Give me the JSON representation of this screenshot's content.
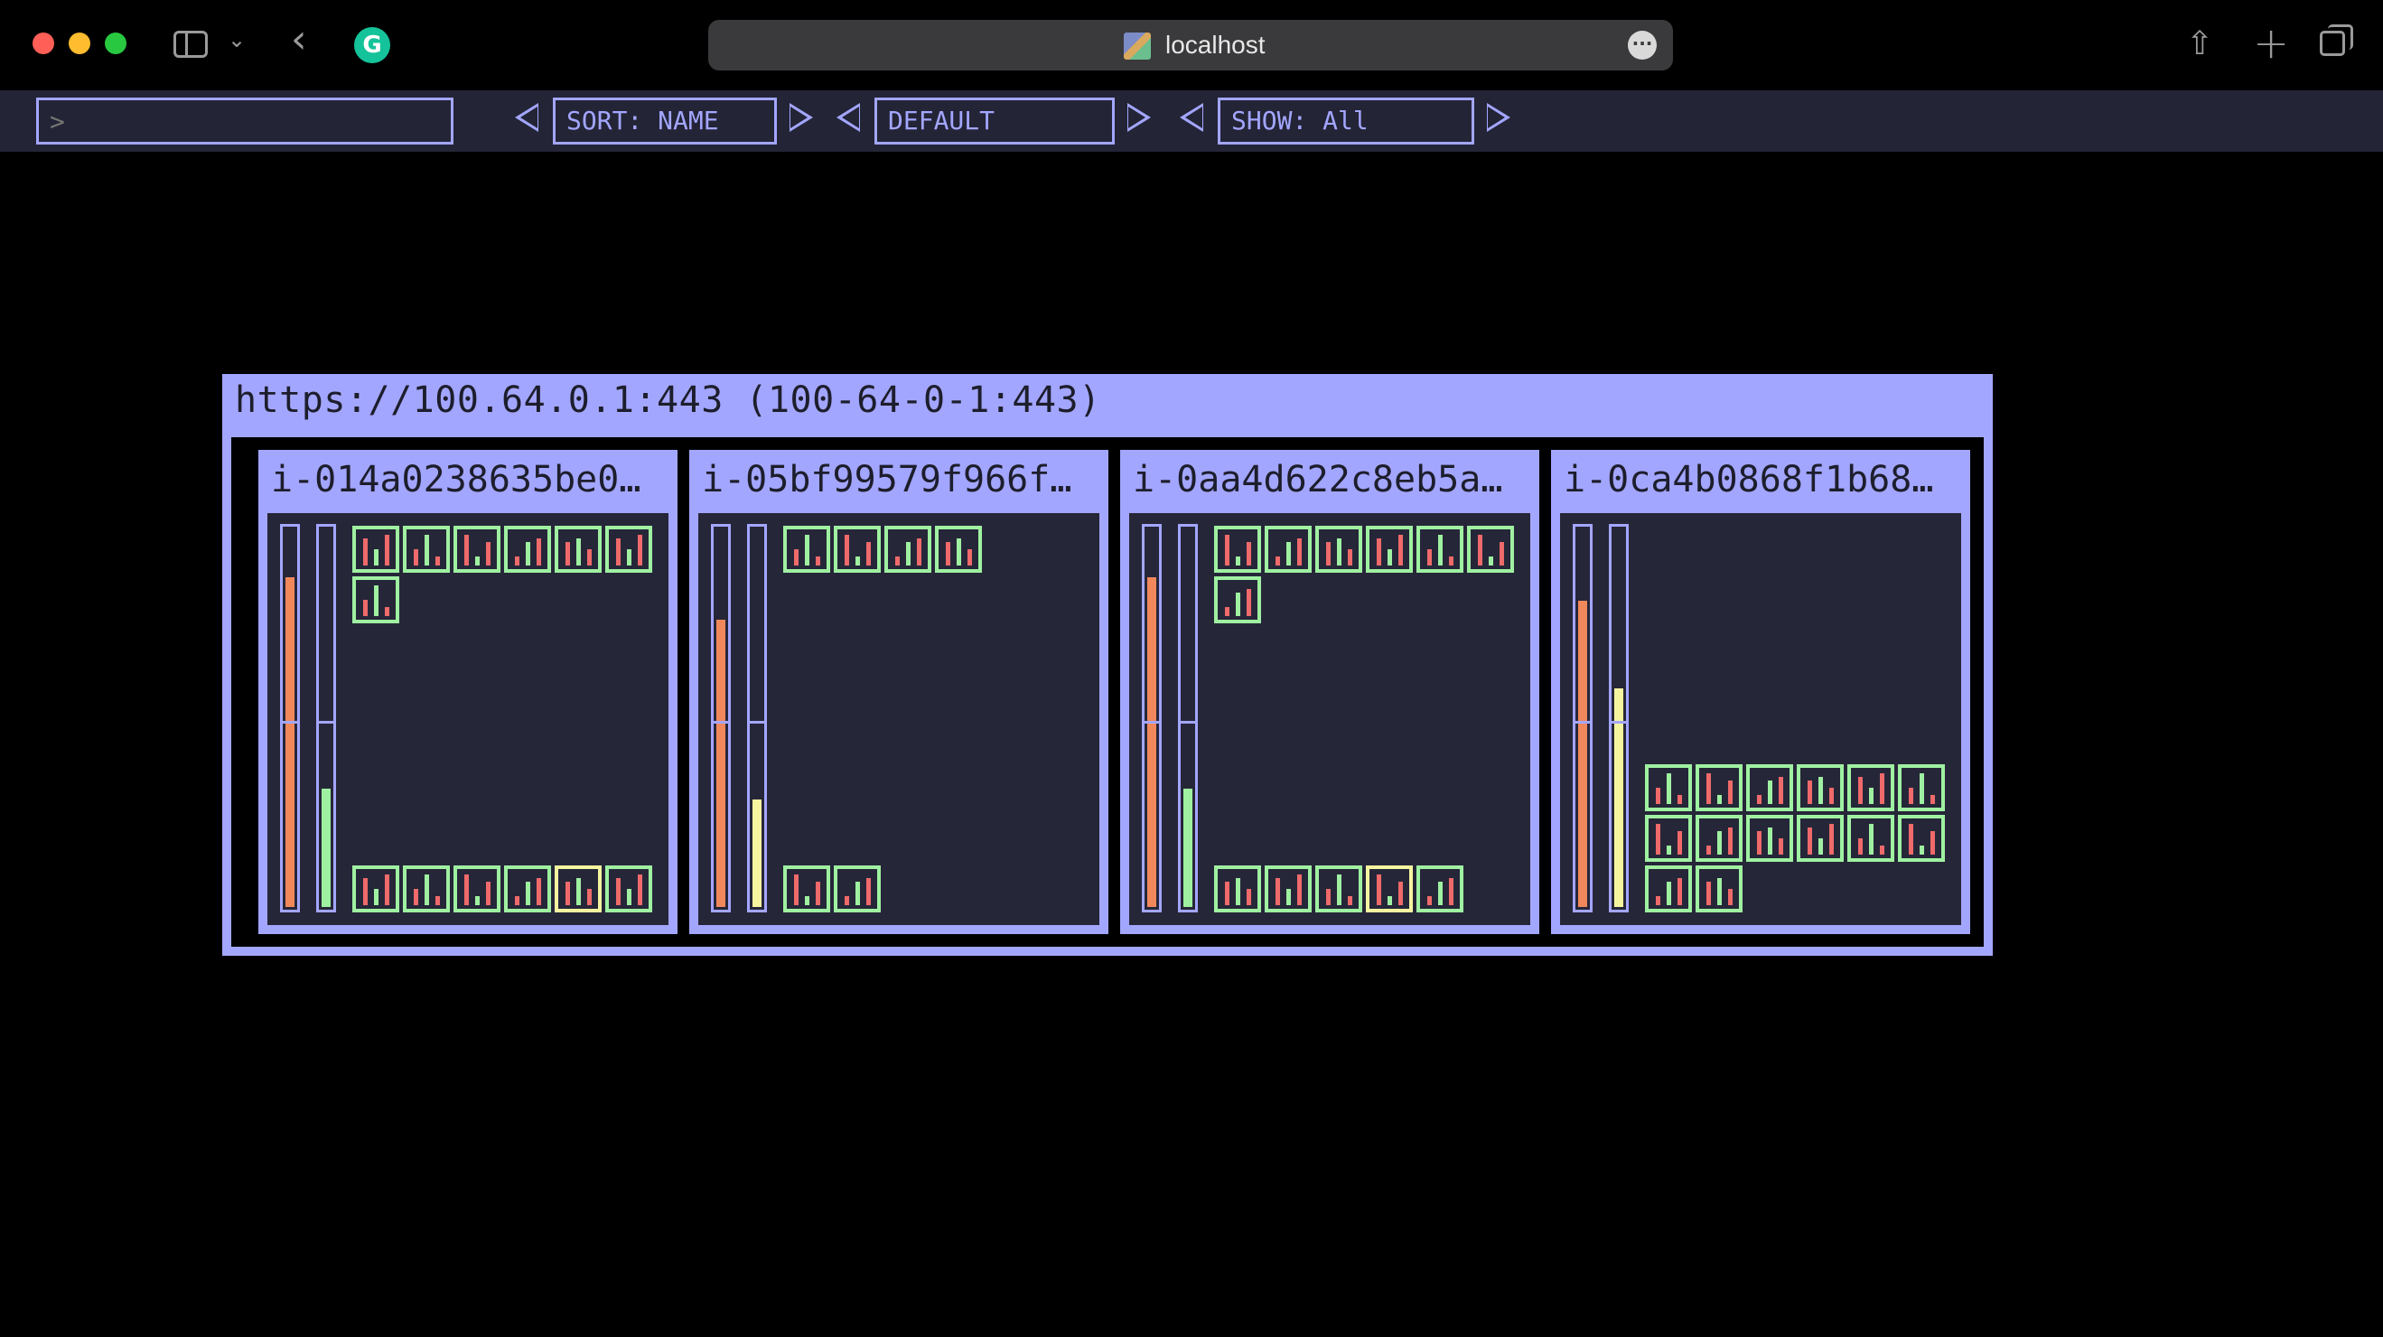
{
  "browser": {
    "url": "localhost",
    "icons": {
      "sidebar": "sidebar-toggle-icon",
      "chevron": "chevron-down-icon",
      "back": "back-arrow-icon",
      "extension": "grammarly-icon",
      "more": "ellipsis-icon",
      "share": "share-icon",
      "new_tab": "plus-icon",
      "tabs": "tab-overview-icon"
    },
    "extension_letter": "G"
  },
  "toolbar": {
    "command_placeholder": ">",
    "sort_label": "SORT: NAME",
    "profile_label": "DEFAULT",
    "show_label": "SHOW: All"
  },
  "colors": {
    "accent": "#a3a6ff",
    "panel_bg": "#262639",
    "pod_ok": "#9ff1a1",
    "pod_warn": "#f5f5a0",
    "cpu": "#f0885c",
    "memory": "#9ff1a1",
    "memory_high": "#f5f5a0",
    "container_fill": "#ef6a6a"
  },
  "cluster": {
    "title": "https://100.64.0.1:443 (100-64-0-1:443)",
    "nodes": [
      {
        "name": "i-014a0238635be0…",
        "cpu_fraction": 0.86,
        "memory_fraction": 0.31,
        "memory_color": "#9ff1a1",
        "pods_top": [
          {
            "status": "ok"
          },
          {
            "status": "ok"
          },
          {
            "status": "ok"
          },
          {
            "status": "ok"
          },
          {
            "status": "ok"
          },
          {
            "status": "ok"
          },
          {
            "status": "ok"
          }
        ],
        "pods_bottom": [
          {
            "status": "ok"
          },
          {
            "status": "ok"
          },
          {
            "status": "ok"
          },
          {
            "status": "ok"
          },
          {
            "status": "warn"
          },
          {
            "status": "ok"
          }
        ]
      },
      {
        "name": "i-05bf99579f966f…",
        "cpu_fraction": 0.75,
        "memory_fraction": 0.28,
        "memory_color": "#f5f5a0",
        "pods_top": [
          {
            "status": "ok"
          },
          {
            "status": "ok"
          },
          {
            "status": "ok"
          },
          {
            "status": "ok"
          }
        ],
        "pods_bottom": [
          {
            "status": "ok"
          },
          {
            "status": "ok"
          }
        ]
      },
      {
        "name": "i-0aa4d622c8eb5a…",
        "cpu_fraction": 0.86,
        "memory_fraction": 0.31,
        "memory_color": "#9ff1a1",
        "pods_top": [
          {
            "status": "ok"
          },
          {
            "status": "ok"
          },
          {
            "status": "ok"
          },
          {
            "status": "ok"
          },
          {
            "status": "ok"
          },
          {
            "status": "ok"
          },
          {
            "status": "ok"
          }
        ],
        "pods_bottom": [
          {
            "status": "ok"
          },
          {
            "status": "ok"
          },
          {
            "status": "ok"
          },
          {
            "status": "warn"
          },
          {
            "status": "ok"
          }
        ]
      },
      {
        "name": "i-0ca4b0868f1b68…",
        "cpu_fraction": 0.8,
        "memory_fraction": 0.57,
        "memory_color": "#f5f5a0",
        "pods_top": [],
        "pods_bottom": [
          {
            "status": "ok"
          },
          {
            "status": "ok"
          },
          {
            "status": "ok"
          },
          {
            "status": "ok"
          },
          {
            "status": "ok"
          },
          {
            "status": "ok"
          },
          {
            "status": "ok"
          },
          {
            "status": "ok"
          },
          {
            "status": "ok"
          },
          {
            "status": "ok"
          },
          {
            "status": "ok"
          },
          {
            "status": "ok"
          },
          {
            "status": "ok"
          },
          {
            "status": "ok"
          }
        ]
      }
    ]
  }
}
